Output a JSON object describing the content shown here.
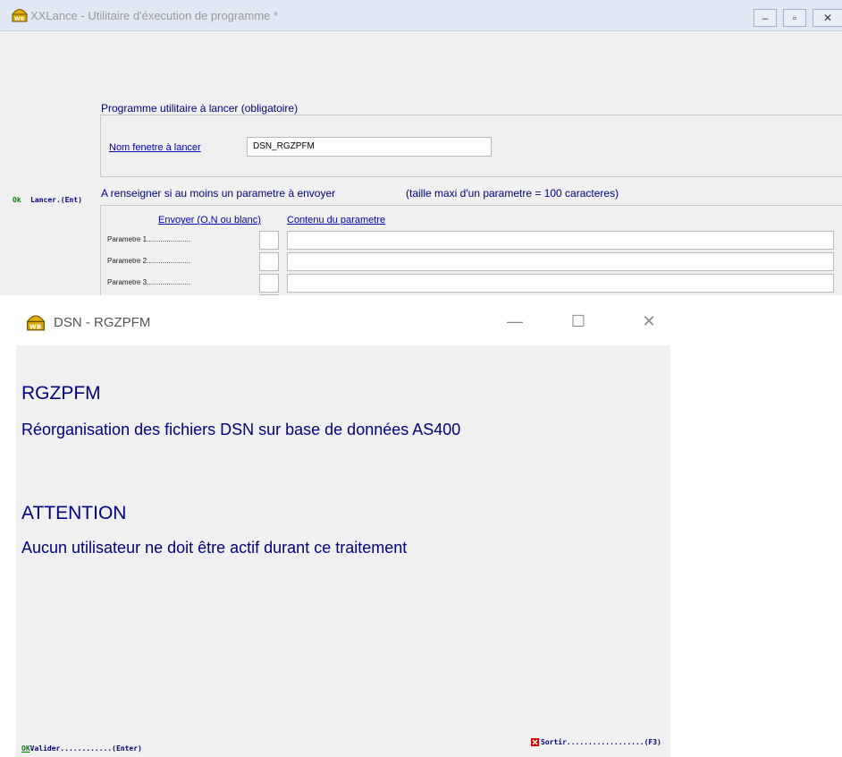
{
  "window1": {
    "title": "XXLance - Utilitaire d'éxecution de programme *",
    "controls": {
      "min": "–",
      "max": "▫",
      "close": "✕"
    },
    "group1": {
      "title": "Programme utilitaire à lancer  (obligatoire)",
      "field_label": "Nom fenetre à lancer",
      "field_value": "DSN_RGZPFM"
    },
    "side_action": {
      "ok": "Ok",
      "label": "Lancer.(Ent)"
    },
    "group2": {
      "title": "A renseigner si au moins un parametre à envoyer",
      "note": "(taille maxi d'un parametre = 100 caracteres)",
      "col_send": "Envoyer (O,N ou blanc)",
      "col_content": "Contenu du parametre",
      "params": [
        {
          "label": "Parametre 1......................",
          "send": "",
          "content": ""
        },
        {
          "label": "Parametre 2......................",
          "send": "",
          "content": ""
        },
        {
          "label": "Parametre 3......................",
          "send": "",
          "content": ""
        }
      ]
    }
  },
  "window2": {
    "title": "DSN - RGZPFM",
    "controls": {
      "min": "—",
      "max": "☐",
      "close": "✕"
    },
    "heading": "RGZPFM",
    "description": "Réorganisation des fichiers DSN sur base de données AS400",
    "warning_title": "ATTENTION",
    "warning_text": "Aucun utilisateur ne doit être actif durant ce traitement",
    "validate": {
      "ok": "OK",
      "label": "Valider............(Enter)"
    },
    "exit": {
      "label": "Sortir..................(F3)"
    }
  }
}
